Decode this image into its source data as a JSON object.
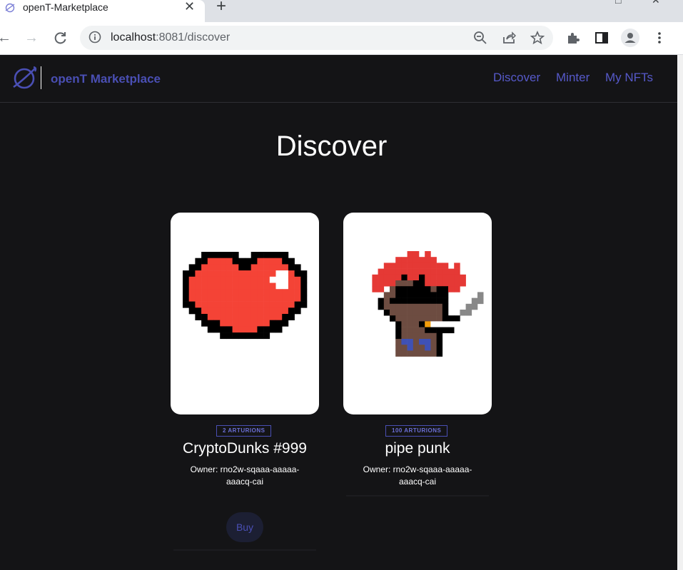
{
  "browser": {
    "tab_title": "openT-Marketplace",
    "tab_close": "✕",
    "new_tab": "+",
    "url_host": "localhost",
    "url_path": ":8081/discover"
  },
  "navbar": {
    "brand": "openT Marketplace",
    "links": [
      "Discover",
      "Minter",
      "My NFTs"
    ]
  },
  "page": {
    "heading": "Discover"
  },
  "nfts": [
    {
      "price_badge": "2 ARTURIONS",
      "name": "CryptoDunks #999",
      "owner": "Owner: rno2w-sqaaa-aaaaa-aaacq-cai",
      "image": "pixel-heart"
    },
    {
      "price_badge": "100 ARTURIONS",
      "name": "pipe punk",
      "owner": "Owner: rno2w-sqaaa-aaaaa-aaacq-cai",
      "image": "pixel-punk"
    }
  ],
  "actions": {
    "buy_label": "Buy"
  },
  "colors": {
    "accent": "#4a4fb4",
    "background": "#141416",
    "heart_red": "#f44336"
  }
}
